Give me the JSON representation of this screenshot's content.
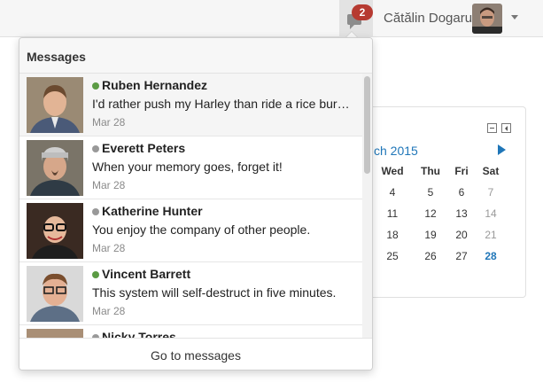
{
  "navbar": {
    "message_count": "2",
    "user_name": "Cătălin Dogaru",
    "icons": {
      "messages": "speech-bubble-icon",
      "menu": "chevron-down-icon"
    }
  },
  "calendar": {
    "month_label": "ch 2015",
    "weekdays": [
      "Wed",
      "Thu",
      "Fri",
      "Sat"
    ],
    "rows": [
      [
        "4",
        "5",
        "6",
        "7"
      ],
      [
        "11",
        "12",
        "13",
        "14"
      ],
      [
        "18",
        "19",
        "20",
        "21"
      ],
      [
        "25",
        "26",
        "27",
        "28"
      ]
    ],
    "icons": {
      "minimize": "minimize-icon",
      "dock": "dock-icon",
      "next": "next-month-icon"
    }
  },
  "messages": {
    "title": "Messages",
    "footer_link": "Go to messages",
    "colors": {
      "online": "#5b9b44",
      "offline": "#999999",
      "badge": "#b63a31",
      "link": "#1f76b8"
    },
    "items": [
      {
        "name": "Ruben Hernandez",
        "text": "I'd rather push my Harley than ride a rice burner.",
        "date": "Mar 28",
        "status": "online"
      },
      {
        "name": "Everett Peters",
        "text": "When your memory goes, forget it!",
        "date": "Mar 28",
        "status": "offline"
      },
      {
        "name": "Katherine Hunter",
        "text": "You enjoy the company of other people.",
        "date": "Mar 28",
        "status": "offline"
      },
      {
        "name": "Vincent Barrett",
        "text": "This system will self-destruct in five minutes.",
        "date": "Mar 28",
        "status": "online"
      },
      {
        "name": "Nicky Torres",
        "text": "",
        "date": "",
        "status": "offline"
      }
    ]
  }
}
